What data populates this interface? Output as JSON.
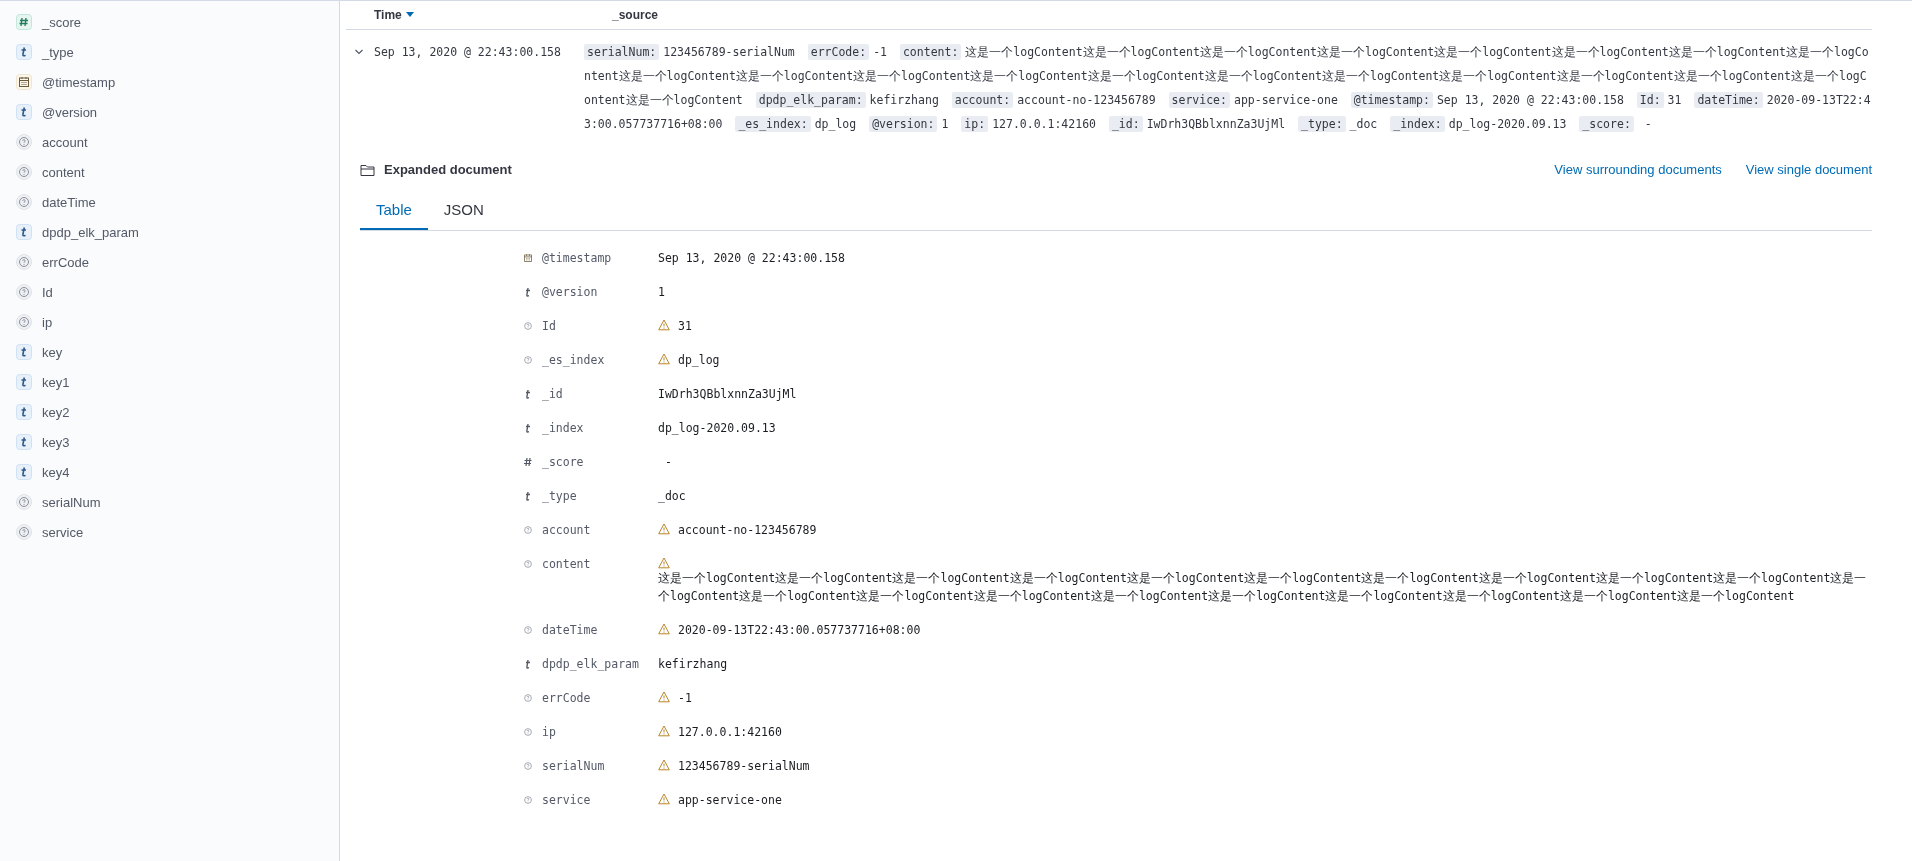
{
  "sidebar": {
    "fields": [
      {
        "name": "_score",
        "kind": "number"
      },
      {
        "name": "_type",
        "kind": "string"
      },
      {
        "name": "@timestamp",
        "kind": "date"
      },
      {
        "name": "@version",
        "kind": "string"
      },
      {
        "name": "account",
        "kind": "unknown"
      },
      {
        "name": "content",
        "kind": "unknown"
      },
      {
        "name": "dateTime",
        "kind": "unknown"
      },
      {
        "name": "dpdp_elk_param",
        "kind": "string"
      },
      {
        "name": "errCode",
        "kind": "unknown"
      },
      {
        "name": "Id",
        "kind": "unknown"
      },
      {
        "name": "ip",
        "kind": "unknown"
      },
      {
        "name": "key",
        "kind": "string"
      },
      {
        "name": "key1",
        "kind": "string"
      },
      {
        "name": "key2",
        "kind": "string"
      },
      {
        "name": "key3",
        "kind": "string"
      },
      {
        "name": "key4",
        "kind": "string"
      },
      {
        "name": "serialNum",
        "kind": "unknown"
      },
      {
        "name": "service",
        "kind": "unknown"
      }
    ]
  },
  "table": {
    "columns": [
      {
        "label": "Time",
        "sorted": true
      },
      {
        "label": "_source",
        "sorted": false
      }
    ],
    "row": {
      "expanded": true,
      "time": "Sep 13, 2020 @ 22:43:00.158",
      "source": [
        {
          "key": "serialNum:",
          "value": "123456789-serialNum"
        },
        {
          "key": "errCode:",
          "value": "-1"
        },
        {
          "key": "content:",
          "value": "这是一个logContent这是一个logContent这是一个logContent这是一个logContent这是一个logContent这是一个logContent这是一个logContent这是一个logContent这是一个logContent这是一个logContent这是一个logContent这是一个logContent这是一个logContent这是一个logContent这是一个logContent这是一个logContent这是一个logContent这是一个logContent这是一个logContent这是一个logContent"
        },
        {
          "key": "dpdp_elk_param:",
          "value": "kefirzhang"
        },
        {
          "key": "account:",
          "value": "account-no-123456789"
        },
        {
          "key": "service:",
          "value": "app-service-one"
        },
        {
          "key": "@timestamp:",
          "value": "Sep 13, 2020 @ 22:43:00.158"
        },
        {
          "key": "Id:",
          "value": "31"
        },
        {
          "key": "dateTime:",
          "value": "2020-09-13T22:43:00.057737716+08:00"
        },
        {
          "key": "_es_index:",
          "value": "dp_log"
        },
        {
          "key": "@version:",
          "value": "1"
        },
        {
          "key": "ip:",
          "value": "127.0.0.1:42160"
        },
        {
          "key": "_id:",
          "value": "IwDrh3QBblxnnZa3UjMl"
        },
        {
          "key": "_type:",
          "value": "_doc"
        },
        {
          "key": "_index:",
          "value": "dp_log-2020.09.13"
        },
        {
          "key": "_score:",
          "value": " -"
        }
      ]
    }
  },
  "expanded_document": {
    "title": "Expanded document",
    "links": [
      "View surrounding documents",
      "View single document"
    ],
    "tabs": [
      {
        "label": "Table",
        "selected": true
      },
      {
        "label": "JSON",
        "selected": false
      }
    ],
    "fields": [
      {
        "name": "@timestamp",
        "kind": "date",
        "warning": false,
        "value": "Sep 13, 2020 @ 22:43:00.158"
      },
      {
        "name": "@version",
        "kind": "string",
        "warning": false,
        "value": "1"
      },
      {
        "name": "Id",
        "kind": "unknown",
        "warning": true,
        "value": "31"
      },
      {
        "name": "_es_index",
        "kind": "unknown",
        "warning": true,
        "value": "dp_log"
      },
      {
        "name": "_id",
        "kind": "string",
        "warning": false,
        "value": "IwDrh3QBblxnnZa3UjMl"
      },
      {
        "name": "_index",
        "kind": "string",
        "warning": false,
        "value": "dp_log-2020.09.13"
      },
      {
        "name": "_score",
        "kind": "number",
        "warning": false,
        "value": " -"
      },
      {
        "name": "_type",
        "kind": "string",
        "warning": false,
        "value": "_doc"
      },
      {
        "name": "account",
        "kind": "unknown",
        "warning": true,
        "value": "account-no-123456789"
      },
      {
        "name": "content",
        "kind": "unknown",
        "warning": true,
        "block": true,
        "value": "这是一个logContent这是一个logContent这是一个logContent这是一个logContent这是一个logContent这是一个logContent这是一个logContent这是一个logContent这是一个logContent这是一个logContent这是一个logContent这是一个logContent这是一个logContent这是一个logContent这是一个logContent这是一个logContent这是一个logContent这是一个logContent这是一个logContent这是一个logContent"
      },
      {
        "name": "dateTime",
        "kind": "unknown",
        "warning": true,
        "value": "2020-09-13T22:43:00.057737716+08:00"
      },
      {
        "name": "dpdp_elk_param",
        "kind": "string",
        "warning": false,
        "value": "kefirzhang"
      },
      {
        "name": "errCode",
        "kind": "unknown",
        "warning": true,
        "value": "-1"
      },
      {
        "name": "ip",
        "kind": "unknown",
        "warning": true,
        "value": "127.0.0.1:42160"
      },
      {
        "name": "serialNum",
        "kind": "unknown",
        "warning": true,
        "value": "123456789-serialNum"
      },
      {
        "name": "service",
        "kind": "unknown",
        "warning": true,
        "value": "app-service-one"
      }
    ]
  }
}
